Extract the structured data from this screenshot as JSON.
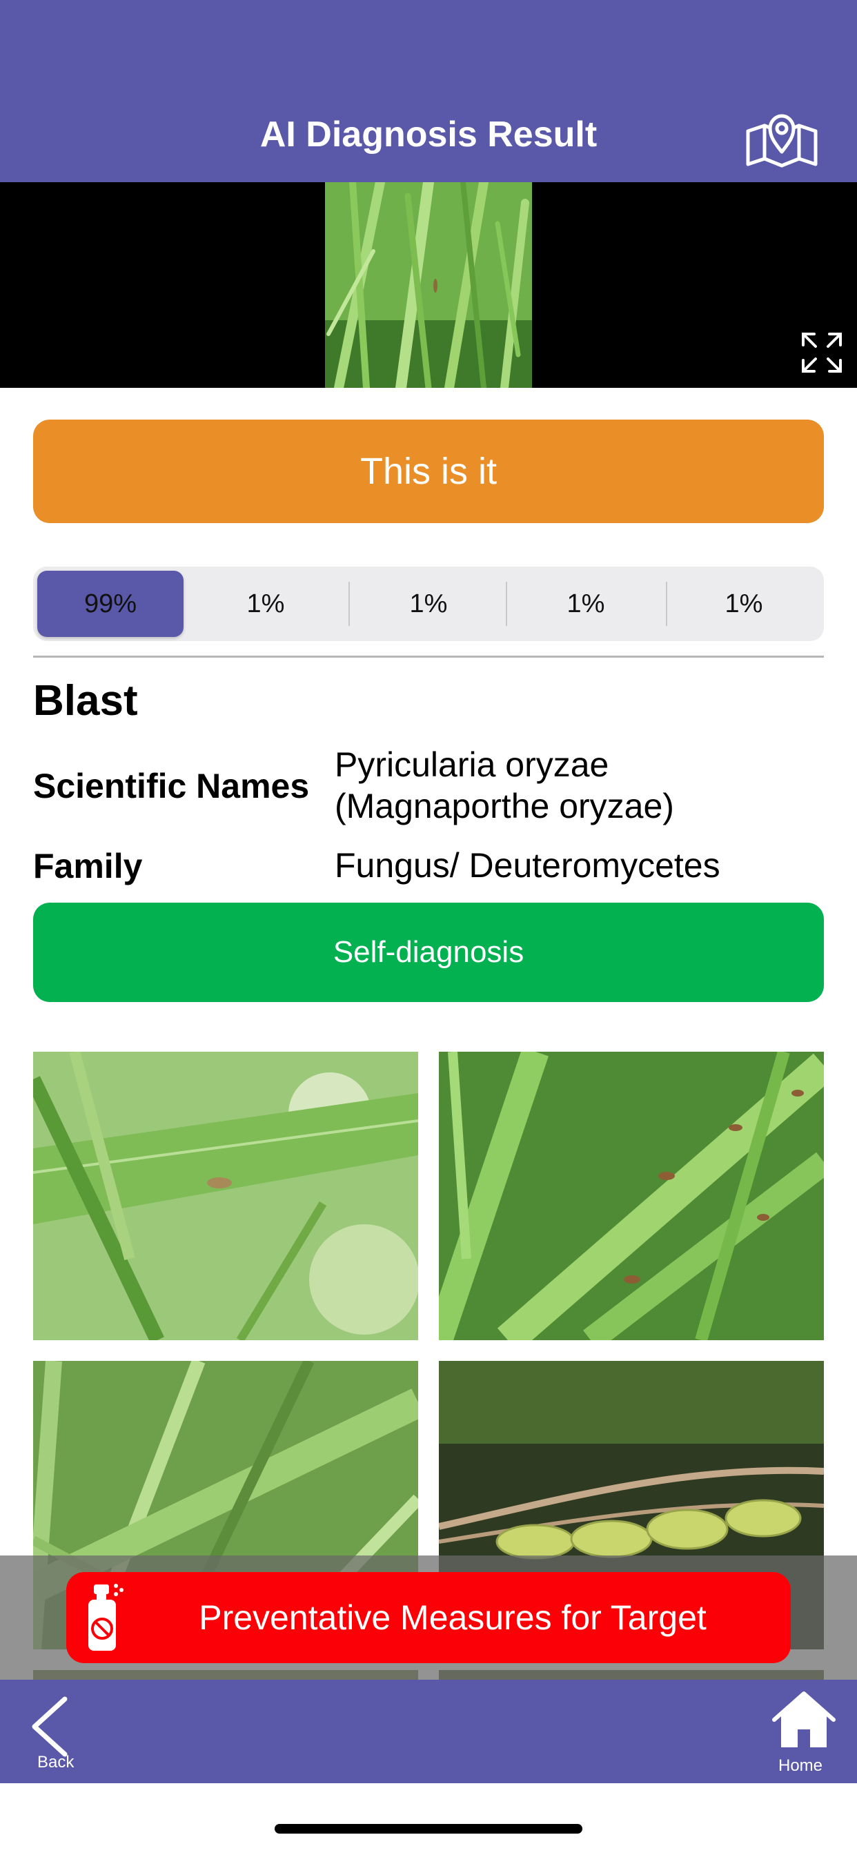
{
  "header": {
    "title": "AI Diagnosis Result",
    "map_icon": "map-pin-icon"
  },
  "photo": {
    "expand_icon": "expand-icon"
  },
  "confirm_button": {
    "label": "This is it"
  },
  "confidence_tabs": [
    {
      "label": "99%",
      "selected": true
    },
    {
      "label": "1%",
      "selected": false
    },
    {
      "label": "1%",
      "selected": false
    },
    {
      "label": "1%",
      "selected": false
    },
    {
      "label": "1%",
      "selected": false
    }
  ],
  "disease": {
    "name": "Blast",
    "scientific_label": "Scientific Names",
    "scientific_value_line1": "Pyricularia oryzae",
    "scientific_value_line2": "(Magnaporthe oryzae)",
    "family_label": "Family",
    "family_value": "Fungus/ Deuteromycetes"
  },
  "self_diagnosis_button": {
    "label": "Self-diagnosis"
  },
  "preventative_button": {
    "label": "Preventative Measures for Target",
    "icon": "spray-can-icon"
  },
  "tabbar": {
    "back_label": "Back",
    "home_label": "Home"
  },
  "colors": {
    "primary": "#5a58a8",
    "confirm": "#ea8e28",
    "self_diagnosis": "#04b151",
    "preventative": "#fb0006"
  }
}
